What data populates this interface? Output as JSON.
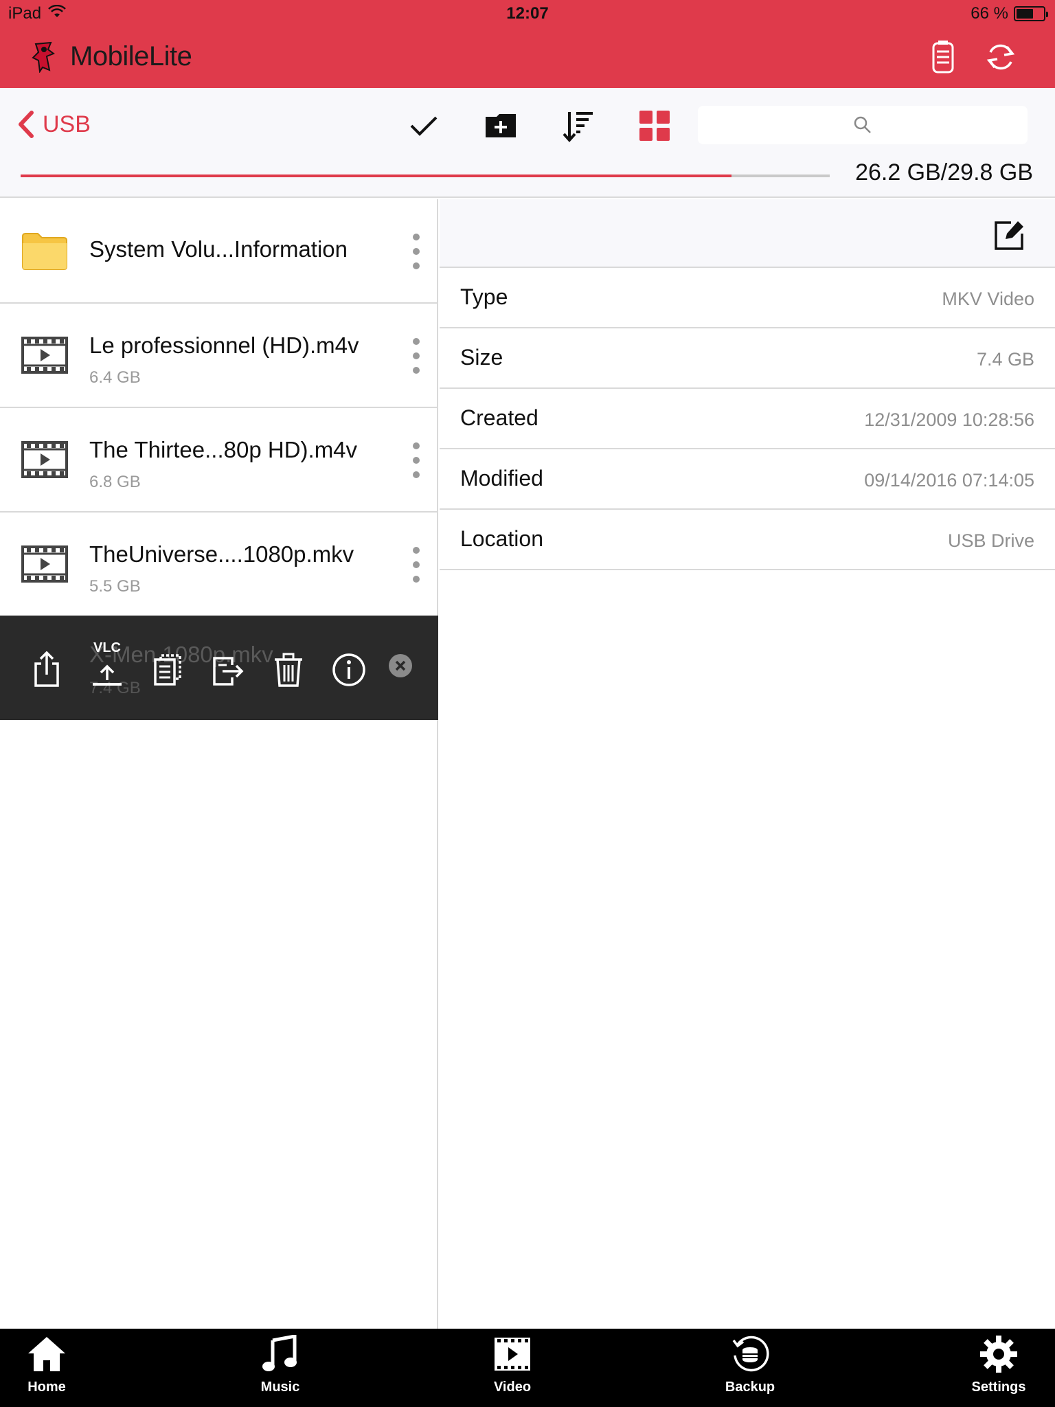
{
  "status_bar": {
    "device": "iPad",
    "time": "12:07",
    "battery": "66 %",
    "battery_level": 0.66
  },
  "header": {
    "app_name": "MobileLite",
    "accent_color": "#df3a4b"
  },
  "toolbar": {
    "back_label": "USB",
    "search": {
      "placeholder": ""
    },
    "storage": {
      "text": "26.2 GB/29.8 GB",
      "used_fraction": 0.879
    }
  },
  "files": [
    {
      "name": "System Volu...Information",
      "size": "",
      "kind": "folder"
    },
    {
      "name": "Le professionnel (HD).m4v",
      "size": "6.4 GB",
      "kind": "video"
    },
    {
      "name": "The Thirtee...80p HD).m4v",
      "size": "6.8 GB",
      "kind": "video"
    },
    {
      "name": "TheUniverse....1080p.mkv",
      "size": "5.5 GB",
      "kind": "video"
    }
  ],
  "selected_file": {
    "name": "X-Men.1080p.mkv",
    "size": "7.4 GB",
    "vlc_label": "VLC"
  },
  "details": {
    "rows": [
      {
        "key": "Type",
        "value": "MKV Video"
      },
      {
        "key": "Size",
        "value": "7.4 GB"
      },
      {
        "key": "Created",
        "value": "12/31/2009 10:28:56"
      },
      {
        "key": "Modified",
        "value": "09/14/2016 07:14:05"
      },
      {
        "key": "Location",
        "value": "USB Drive"
      }
    ]
  },
  "tabs": [
    {
      "label": "Home",
      "icon": "home-icon"
    },
    {
      "label": "Music",
      "icon": "music-icon"
    },
    {
      "label": "Video",
      "icon": "video-icon"
    },
    {
      "label": "Backup",
      "icon": "backup-icon"
    },
    {
      "label": "Settings",
      "icon": "gear-icon"
    }
  ]
}
